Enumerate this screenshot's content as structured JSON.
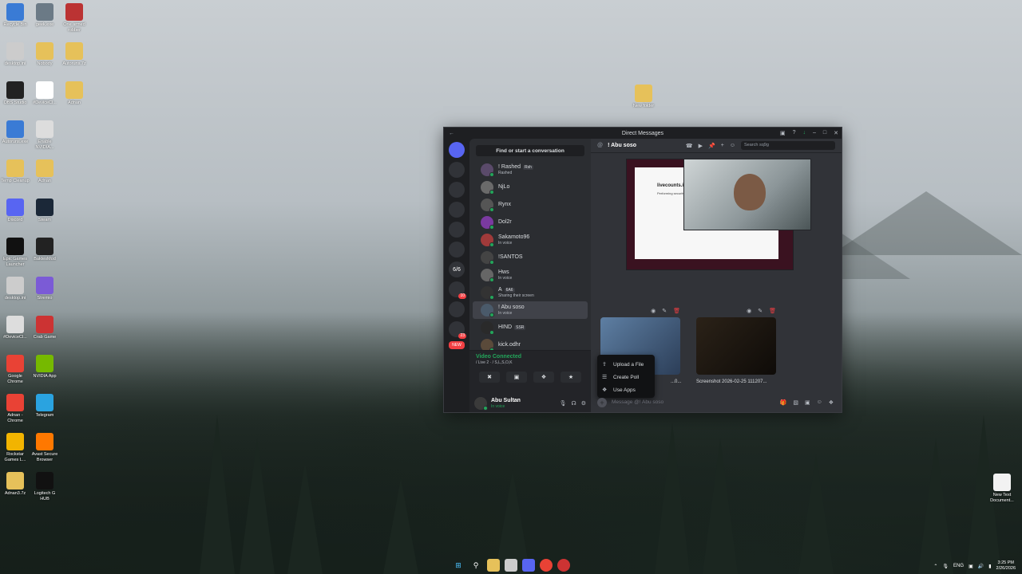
{
  "desktop": {
    "icons": [
      {
        "label": "Recycle Bin",
        "icon": "recycle-bin-icon",
        "color": "#3a7bd5"
      },
      {
        "label": "geek.exe",
        "icon": "app-icon",
        "color": "#6b7a86"
      },
      {
        "label": "One armed robber",
        "icon": "game-icon",
        "color": "#b33"
      },
      {
        "label": "desktop.ini",
        "icon": "file-icon",
        "color": "#ccc"
      },
      {
        "label": "Nobody",
        "icon": "folder-icon",
        "color": "#e6c15a"
      },
      {
        "label": "Autoruns.7z",
        "icon": "archive-icon",
        "color": "#e6c15a"
      },
      {
        "label": "OBS Studio",
        "icon": "obs-icon",
        "color": "#222"
      },
      {
        "label": "#DeviceCl...",
        "icon": "devcln-icon",
        "color": "#fff"
      },
      {
        "label": "Adnan",
        "icon": "folder-icon",
        "color": "#e6c15a"
      },
      {
        "label": "Autoruns.exe",
        "icon": "app-icon",
        "color": "#3a7bd5"
      },
      {
        "label": "Enable NVIDIA...",
        "icon": "file-icon",
        "color": "#ddd"
      },
      {
        "label": "Temp Cleanup",
        "icon": "folder-icon",
        "color": "#e6c15a"
      },
      {
        "label": "Adnan",
        "icon": "folder-icon",
        "color": "#e6c15a"
      },
      {
        "label": "Discord",
        "icon": "discord-icon",
        "color": "#5865f2"
      },
      {
        "label": "Steam",
        "icon": "steam-icon",
        "color": "#1b2838"
      },
      {
        "label": "Epic Games Launcher",
        "icon": "epic-icon",
        "color": "#111"
      },
      {
        "label": "BaktesMod",
        "icon": "app-icon",
        "color": "#222"
      },
      {
        "label": "desktop.ini",
        "icon": "file-icon",
        "color": "#ccc"
      },
      {
        "label": "Stremio",
        "icon": "stremio-icon",
        "color": "#7b5bd6"
      },
      {
        "label": "#DeviceCl...",
        "icon": "file-icon",
        "color": "#ddd"
      },
      {
        "label": "Crab Game",
        "icon": "game-icon",
        "color": "#c33"
      },
      {
        "label": "Google Chrome",
        "icon": "chrome-icon",
        "color": "#e94235"
      },
      {
        "label": "NVIDIA App",
        "icon": "nvidia-icon",
        "color": "#76b900"
      },
      {
        "label": "Adnan - Chrome",
        "icon": "chrome-icon",
        "color": "#e94235"
      },
      {
        "label": "Telegram",
        "icon": "telegram-icon",
        "color": "#2aa3e0"
      },
      {
        "label": "Rockstar Games L...",
        "icon": "rockstar-icon",
        "color": "#f2b400"
      },
      {
        "label": "Avast Secure Browser",
        "icon": "avast-icon",
        "color": "#ff7800"
      },
      {
        "label": "Adnan3.7z",
        "icon": "archive-icon",
        "color": "#e6c15a"
      },
      {
        "label": "Logitech G HUB",
        "icon": "logitech-icon",
        "color": "#111"
      }
    ],
    "new_folder": "New folder",
    "new_text_doc": "New Text Document..."
  },
  "window": {
    "title": "Direct Messages"
  },
  "servers": [
    {
      "label": "",
      "icon": "discord-icon",
      "badge": ""
    },
    {
      "label": "",
      "icon": "server-icon",
      "badge": ""
    },
    {
      "label": "",
      "icon": "server-icon",
      "badge": ""
    },
    {
      "label": "",
      "icon": "server-icon",
      "badge": ""
    },
    {
      "label": "",
      "icon": "server-icon",
      "badge": ""
    },
    {
      "label": "",
      "icon": "server-icon",
      "badge": ""
    },
    {
      "label": "6/6",
      "icon": "server-icon",
      "badge": ""
    },
    {
      "label": "",
      "icon": "server-icon",
      "badge": "10"
    },
    {
      "label": "",
      "icon": "server-icon",
      "badge": ""
    },
    {
      "label": "",
      "icon": "server-icon",
      "badge": "23"
    },
    {
      "label": "NEW",
      "icon": "new-icon",
      "badge": ""
    }
  ],
  "dm": {
    "find": "Find or start a conversation",
    "items": [
      {
        "name": "! Rashed",
        "tag": "Rsh",
        "sub": "Rashed",
        "color": "#5a4a6a"
      },
      {
        "name": "NjLo",
        "tag": "",
        "sub": "",
        "color": "#6a6a6a"
      },
      {
        "name": "Rynx",
        "tag": "",
        "sub": "",
        "color": "#555"
      },
      {
        "name": "Dol2r",
        "tag": "",
        "sub": "",
        "color": "#7a3aa0"
      },
      {
        "name": "Sakamoto96",
        "tag": "",
        "sub": "In voice",
        "color": "#a03a3a"
      },
      {
        "name": "!SANTOS",
        "tag": "",
        "sub": "",
        "color": "#444"
      },
      {
        "name": "Hws",
        "tag": "",
        "sub": "In voice",
        "color": "#666"
      },
      {
        "name": "A",
        "tag": "6A6",
        "sub": "Sharing their screen",
        "color": "#333"
      },
      {
        "name": "! Abu soso",
        "tag": "",
        "sub": "In voice",
        "color": "#4a5a6a"
      },
      {
        "name": "HIND",
        "tag": "SSR",
        "sub": "",
        "color": "#2a2a2a"
      },
      {
        "name": "kick.odhr",
        "tag": "",
        "sub": "",
        "color": "#5a4a3a"
      }
    ]
  },
  "voice": {
    "title": "Video Connected",
    "sub": "/ Live 2 · / S,L,S,O,K"
  },
  "user": {
    "name": "Abu Sultan",
    "status": "In voice"
  },
  "chat": {
    "recipient": "! Abu soso",
    "search_placeholder": "Search sq9g",
    "shared_title": "livecounts.io",
    "shared_sub": "Performing security verification",
    "attachments": [
      {
        "caption": "...0..."
      },
      {
        "caption": "Screenshot 2026-02-25 111207..."
      }
    ],
    "popup": [
      {
        "label": "Upload a File",
        "icon": "upload-icon"
      },
      {
        "label": "Create Poll",
        "icon": "poll-icon"
      },
      {
        "label": "Use Apps",
        "icon": "apps-icon"
      }
    ],
    "message_placeholder": "Message @! Abu soso"
  },
  "taskbar": {
    "lang": "ENG",
    "time": "3:25 PM",
    "date": "2/26/2026"
  }
}
